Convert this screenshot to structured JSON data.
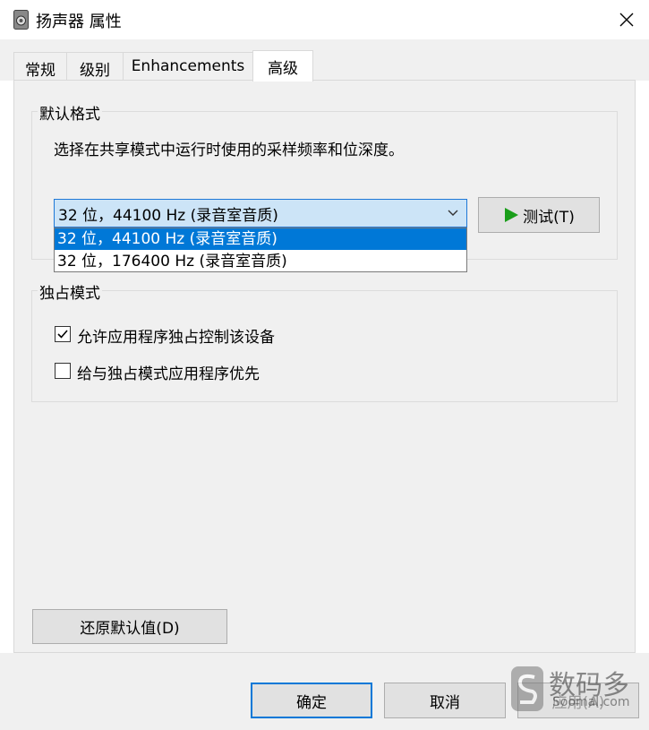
{
  "window": {
    "title": "扬声器 属性",
    "close_glyph": "✕"
  },
  "tabs": [
    {
      "label": "常规"
    },
    {
      "label": "级别"
    },
    {
      "label": "Enhancements"
    },
    {
      "label": "高级",
      "active": true
    }
  ],
  "default_format": {
    "group_label": "默认格式",
    "description": "选择在共享模式中运行时使用的采样频率和位深度。",
    "selected": "32 位，44100 Hz (录音室音质)",
    "options": [
      "32 位，44100 Hz (录音室音质)",
      "32 位，176400 Hz (录音室音质)"
    ],
    "test_button": "测试(T)",
    "play_icon": "play-icon",
    "play_color": "#1a9e1a"
  },
  "exclusive_mode": {
    "group_label": "独占模式",
    "options": [
      {
        "label": "允许应用程序独占控制该设备",
        "checked": true
      },
      {
        "label": "给与独占模式应用程序优先",
        "checked": false
      }
    ]
  },
  "restore_button": "还原默认值(D)",
  "footer": {
    "ok": "确定",
    "cancel": "取消",
    "apply": "应用(A)"
  },
  "watermark": {
    "text": "数码多",
    "sub": "Soomal.com"
  },
  "colors": {
    "accent": "#0078d7",
    "selection": "#cce4f7"
  }
}
